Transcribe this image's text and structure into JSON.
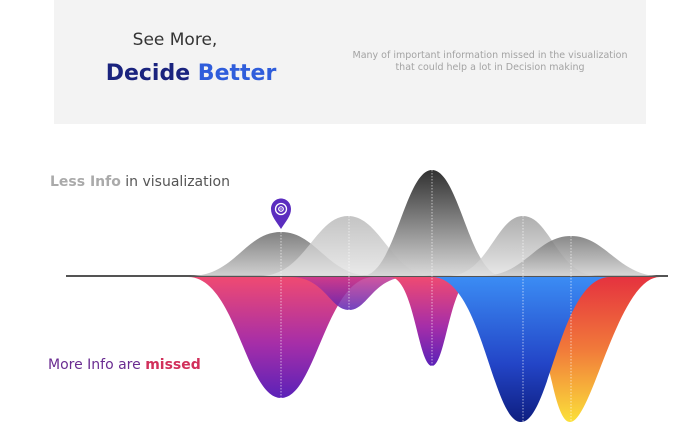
{
  "banner": {
    "line1": "See More,",
    "line2_part1": "Decide",
    "line2_part2": "Better",
    "tagline": "Many of important information missed in the visualization that could help a lot in Decision making"
  },
  "labels": {
    "less_highlight": "Less Info",
    "less_rest": " in visualization",
    "more_start": "More Info are ",
    "more_highlight": "missed"
  },
  "colors": {
    "title_dark": "#1a237e",
    "title_accent": "#2f5ddb",
    "pin": "#5b2dbf"
  },
  "icons": {
    "pin": "target-location-pin-icon"
  }
}
